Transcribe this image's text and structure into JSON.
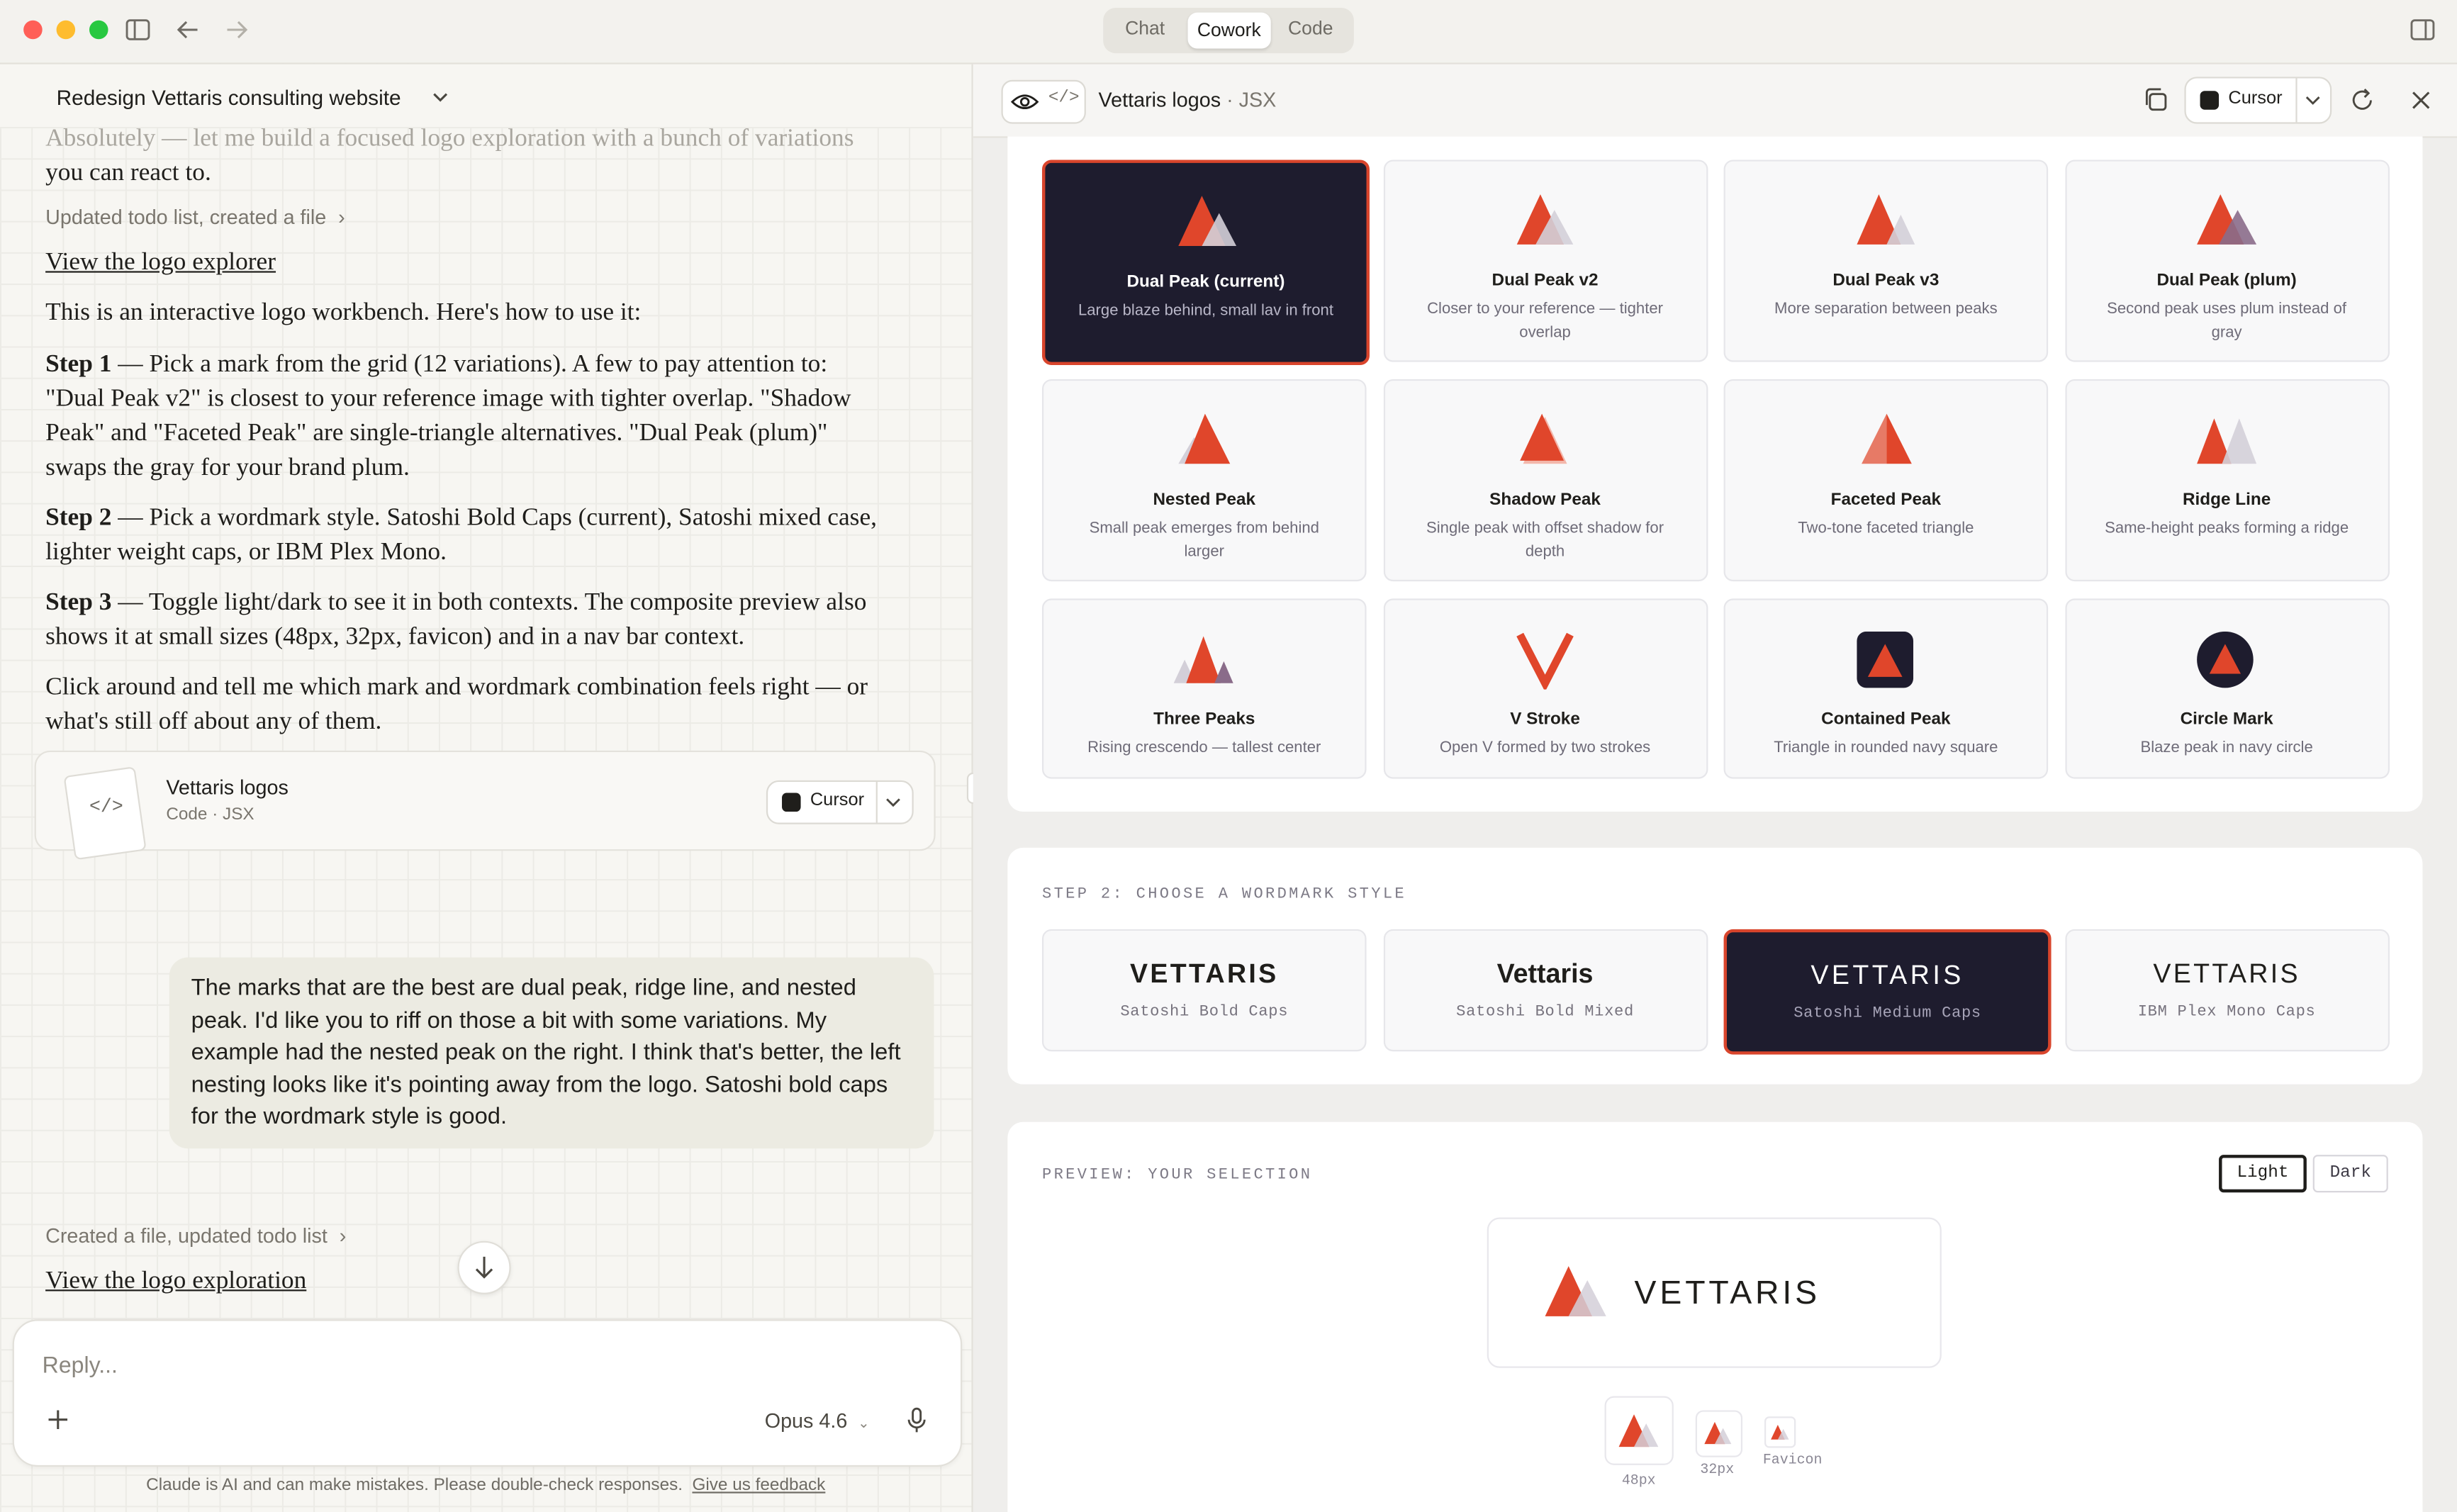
{
  "window": {
    "tabs": [
      {
        "label": "Chat",
        "active": false
      },
      {
        "label": "Cowork",
        "active": true
      },
      {
        "label": "Code",
        "active": false
      }
    ]
  },
  "chat": {
    "title": "Redesign Vettaris consulting website",
    "intro_line1": "Absolutely — let me build a focused logo exploration with a bunch of variations",
    "intro_line2": "you can react to.",
    "meta1": "Updated todo list, created a file",
    "link1": "View the logo explorer",
    "p_how": "This is an interactive logo workbench. Here's how to use it:",
    "step1_label": "Step 1",
    "step1_text": " — Pick a mark from the grid (12 variations). A few to pay attention to: \"Dual Peak v2\" is closest to your reference image with tighter overlap. \"Shadow Peak\" and \"Faceted Peak\" are single-triangle alternatives. \"Dual Peak (plum)\" swaps the gray for your brand plum.",
    "step2_label": "Step 2",
    "step2_text": " — Pick a wordmark style. Satoshi Bold Caps (current), Satoshi mixed case, lighter weight caps, or IBM Plex Mono.",
    "step3_label": "Step 3",
    "step3_text": " — Toggle light/dark to see it in both contexts. The composite preview also shows it at small sizes (48px, 32px, favicon) and in a nav bar context.",
    "p_click": "Click around and tell me which mark and wordmark combination feels right — or what's still off about any of them.",
    "artifact": {
      "title": "Vettaris logos",
      "subtitle": "Code · JSX",
      "button": "Cursor"
    },
    "user_message": "The marks that are the best are dual peak, ridge line, and nested peak. I'd like you to riff on those a bit with some variations. My example had the nested peak on the right. I think that's better, the left nesting looks like it's pointing away from the logo. Satoshi bold caps for the wordmark style is good.",
    "meta2": "Created a file, updated todo list",
    "link2": "View the logo exploration",
    "reply_placeholder": "Reply...",
    "model": "Opus 4.6",
    "disclaimer": "Claude is AI and can make mistakes. Please double-check responses.",
    "feedback": "Give us feedback"
  },
  "artifact_panel": {
    "title": "Vettaris logos",
    "type": " · JSX",
    "open_button": "Cursor",
    "marks": [
      {
        "name": "Dual Peak (current)",
        "desc": "Large blaze behind, small lav in front",
        "selected": true
      },
      {
        "name": "Dual Peak v2",
        "desc": "Closer to your reference — tighter overlap",
        "selected": false
      },
      {
        "name": "Dual Peak v3",
        "desc": "More separation between peaks",
        "selected": false
      },
      {
        "name": "Dual Peak (plum)",
        "desc": "Second peak uses plum instead of gray",
        "selected": false
      },
      {
        "name": "Nested Peak",
        "desc": "Small peak emerges from behind larger",
        "selected": false
      },
      {
        "name": "Shadow Peak",
        "desc": "Single peak with offset shadow for depth",
        "selected": false
      },
      {
        "name": "Faceted Peak",
        "desc": "Two-tone faceted triangle",
        "selected": false
      },
      {
        "name": "Ridge Line",
        "desc": "Same-height peaks forming a ridge",
        "selected": false
      },
      {
        "name": "Three Peaks",
        "desc": "Rising crescendo — tallest center",
        "selected": false
      },
      {
        "name": "V Stroke",
        "desc": "Open V formed by two strokes",
        "selected": false
      },
      {
        "name": "Contained Peak",
        "desc": "Triangle in rounded navy square",
        "selected": false
      },
      {
        "name": "Circle Mark",
        "desc": "Blaze peak in navy circle",
        "selected": false
      }
    ],
    "step2_heading": "STEP 2: CHOOSE A WORDMARK STYLE",
    "wordmarks": [
      {
        "word": "VETTARIS",
        "style": "Satoshi Bold Caps",
        "selected": false
      },
      {
        "word": "Vettaris",
        "style": "Satoshi Bold Mixed",
        "selected": false
      },
      {
        "word": "VETTARIS",
        "style": "Satoshi Medium Caps",
        "selected": true
      },
      {
        "word": "VETTARIS",
        "style": "IBM Plex Mono Caps",
        "selected": false
      }
    ],
    "preview_heading": "PREVIEW: YOUR SELECTION",
    "toggle_light": "Light",
    "toggle_dark": "Dark",
    "preview_word": "VETTARIS",
    "sizes": [
      "48px",
      "32px",
      "Favicon"
    ]
  },
  "colors": {
    "blaze": "#e0462b",
    "lav": "#d3cfd8",
    "plum": "#8a6c8a",
    "navy": "#1e1c2e",
    "accent_border": "#d9452c"
  }
}
